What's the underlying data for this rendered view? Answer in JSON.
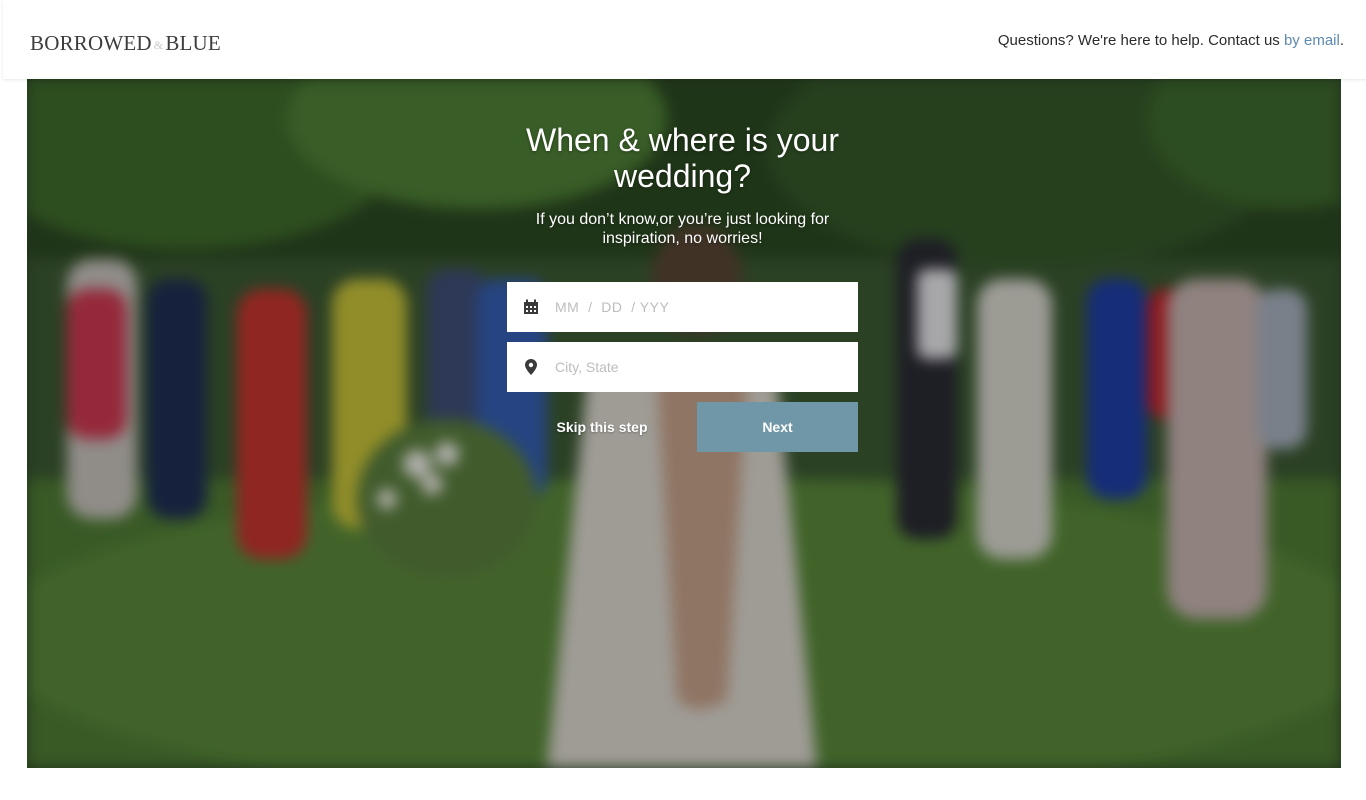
{
  "header": {
    "logo": {
      "word1": "BORROWED",
      "amp": "&",
      "word2": "BLUE"
    },
    "help_text": "Questions? We're here to help. Contact us ",
    "help_link": "by email",
    "help_end": "."
  },
  "hero": {
    "title": "When & where is your wedding?",
    "subtitle": "If you don’t know,or you’re just looking for inspiration, no worries!",
    "date_placeholder": "MM  /  DD  / YYY",
    "location_placeholder": "City, State",
    "skip_label": "Skip this step",
    "next_label": "Next"
  },
  "icons": {
    "date": "calendar-icon",
    "location": "map-pin-icon"
  },
  "colors": {
    "accent": "#6f97a8",
    "link": "#5d8ab0"
  }
}
